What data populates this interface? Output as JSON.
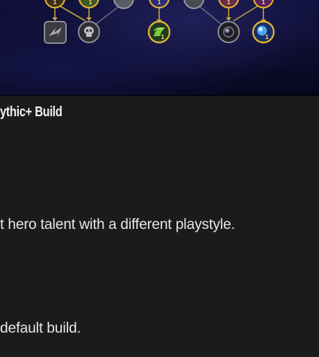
{
  "talent_tree": {
    "icons": [
      {
        "name": "talent-node-top-1",
        "kind": "gold",
        "rank": "1"
      },
      {
        "name": "talent-node-top-2",
        "kind": "gold",
        "rank": "1"
      },
      {
        "name": "talent-node-top-3",
        "kind": "silver",
        "rank": ""
      },
      {
        "name": "talent-node-top-4",
        "kind": "gold",
        "rank": "1"
      },
      {
        "name": "talent-node-top-5",
        "kind": "silver",
        "rank": ""
      },
      {
        "name": "talent-node-top-6",
        "kind": "gold",
        "rank": "1"
      },
      {
        "name": "talent-node-top-7",
        "kind": "gold",
        "rank": "1"
      },
      {
        "name": "talent-node-storm",
        "kind": "square-silver",
        "rank": ""
      },
      {
        "name": "talent-node-skull",
        "kind": "silver",
        "rank": ""
      },
      {
        "name": "talent-node-nature",
        "kind": "gold",
        "rank": "1"
      },
      {
        "name": "talent-node-void",
        "kind": "silver",
        "rank": ""
      },
      {
        "name": "talent-node-frost",
        "kind": "gold",
        "rank": "1"
      }
    ]
  },
  "section": {
    "title": "ythic+ Build"
  },
  "paragraphs": {
    "line_1": "t hero talent with a different playstyle.",
    "line_2": "default build."
  }
}
